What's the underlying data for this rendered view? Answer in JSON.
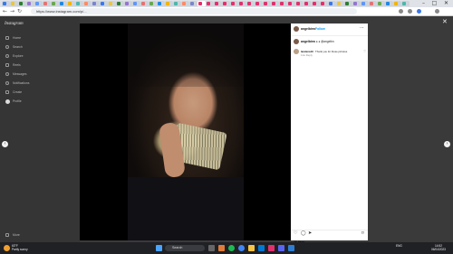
{
  "browser": {
    "tab_colors": [
      "#3b78e7",
      "#e8c547",
      "#2e7d32",
      "#9575cd",
      "#5e97f6",
      "#e57373",
      "#6aa84f",
      "#1e88e5",
      "#f4b400",
      "#4db6ac",
      "#ff8a65",
      "#7986cb",
      "#3b78e7",
      "#e8c547",
      "#2e7d32",
      "#9575cd",
      "#5e97f6",
      "#e57373",
      "#6aa84f",
      "#1e88e5",
      "#f4b400",
      "#4db6ac",
      "#ff8a65",
      "#7986cb",
      "#e1306c",
      "#e1306c",
      "#e1306c",
      "#e1306c",
      "#e1306c",
      "#e1306c",
      "#e1306c",
      "#e1306c",
      "#e1306c",
      "#e1306c",
      "#e1306c",
      "#e1306c",
      "#e1306c",
      "#e1306c",
      "#e1306c",
      "#e1306c",
      "#3b78e7",
      "#e8c547",
      "#2e7d32",
      "#9575cd",
      "#5e97f6",
      "#e57373",
      "#6aa84f",
      "#1e88e5",
      "#f4b400",
      "#4db6ac"
    ],
    "url": "https://www.instagram.com/p/...",
    "minimize": "–",
    "maximize": "□",
    "close": "✕",
    "back": "←",
    "forward": "→",
    "reload": "↻"
  },
  "sidebar": {
    "logo": "Instagram",
    "items": [
      {
        "label": "Home",
        "icon": "home-icon"
      },
      {
        "label": "Search",
        "icon": "search-icon"
      },
      {
        "label": "Explore",
        "icon": "compass-icon"
      },
      {
        "label": "Reels",
        "icon": "reels-icon"
      },
      {
        "label": "Messages",
        "icon": "messenger-icon"
      },
      {
        "label": "Notifications",
        "icon": "heart-icon"
      },
      {
        "label": "Create",
        "icon": "plus-icon"
      },
      {
        "label": "Profile",
        "icon": "profile-avatar"
      }
    ],
    "more": "More"
  },
  "post": {
    "username": "angelbirw",
    "follow": "Follow",
    "caption_user": "angelbirw",
    "caption_text": "♦ ♦ @angelbn",
    "comment_user": "laralena19",
    "comment_text": "Thank you for these pictures",
    "comment_meta": "11w Reply",
    "likes": "76 likes",
    "date": "April 5",
    "more_icon": "⋯",
    "like_icon": "♡",
    "comment_icon": "◯",
    "share_icon": "➤",
    "save_icon": "⌑"
  },
  "viewer": {
    "prev_icon": "‹",
    "next_icon": "›",
    "close_icon": "✕"
  },
  "taskbar": {
    "search_placeholder": "Search",
    "weather_temp": "63°F",
    "weather_desc": "Partly sunny",
    "time": "14:52",
    "date": "06/04/2023",
    "lang": "ENG"
  }
}
